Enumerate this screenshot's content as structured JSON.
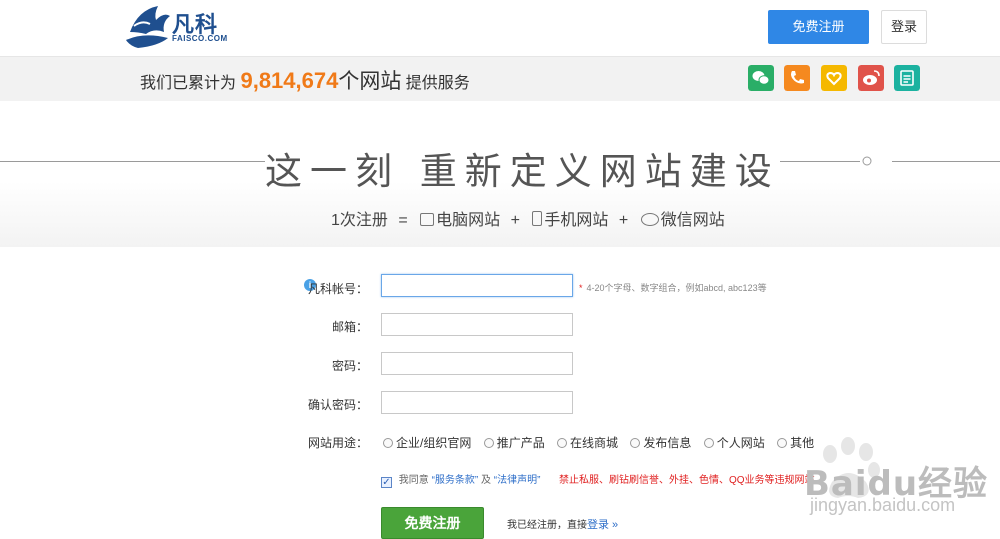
{
  "brand": {
    "name": "凡科",
    "domain": "FAISCO.COM"
  },
  "header": {
    "register_label": "免费注册",
    "login_label": "登录"
  },
  "stats": {
    "prefix": "我们已累计为",
    "count": "9,814,674",
    "unit": "个网站",
    "suffix": "提供服务"
  },
  "share_icons": [
    {
      "name": "wechat-icon",
      "color": "#2aae67"
    },
    {
      "name": "phone-icon",
      "color": "#f5891f"
    },
    {
      "name": "heart-icon",
      "color": "#f5b800"
    },
    {
      "name": "weibo-icon",
      "color": "#e0534a"
    },
    {
      "name": "note-icon",
      "color": "#1cb2a0"
    }
  ],
  "banner": {
    "slogan": "这一刻 重新定义网站建设",
    "formula": {
      "lead": "1次注册",
      "eq": "=",
      "pc": "电脑网站",
      "plus1": "+",
      "mobile": "手机网站",
      "plus2": "+",
      "wechat": "微信网站"
    }
  },
  "form": {
    "account_label": "凡科帐号：",
    "account_hint": "4-20个字母、数字组合，例如abcd, abc123等",
    "email_label": "邮箱：",
    "password_label": "密码：",
    "confirm_label": "确认密码：",
    "purpose_label": "网站用途：",
    "purpose_options": [
      "企业/组织官网",
      "推广产品",
      "在线商城",
      "发布信息",
      "个人网站",
      "其他"
    ],
    "agree_prefix": "我同意",
    "terms_link": "“服务条款”",
    "agree_and": "及",
    "statement_link": "“法律声明”",
    "warning": "禁止私服、刷钻刷信誉、外挂、色情、QQ业务等违规网站",
    "submit_label": "免费注册",
    "already_text": "我已经注册，直接",
    "login_link": "登录 »"
  },
  "watermark": {
    "text": "Baidu经验",
    "url": "jingyan.baidu.com"
  },
  "colors": {
    "accent": "#2f87e6",
    "orange": "#f07a18",
    "green": "#4aa43a",
    "warn": "#e02020"
  }
}
